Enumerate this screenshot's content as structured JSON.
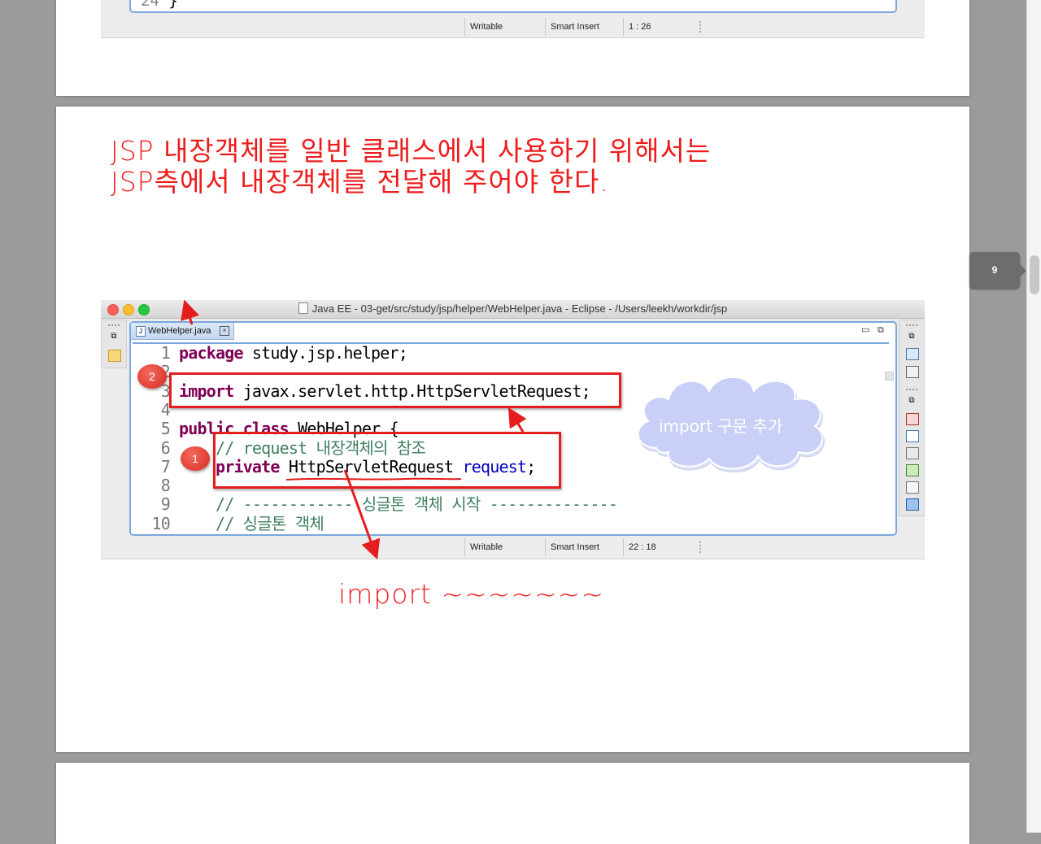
{
  "viewer": {
    "page_indicator": "9"
  },
  "prev_slide": {
    "visible_line_number": "24",
    "visible_code": "}",
    "status": {
      "writable": "Writable",
      "insert_mode": "Smart Insert",
      "position": "1 : 26"
    }
  },
  "slide": {
    "title_line1": "JSP 내장객체를 일반 클래스에서 사용하기 위해서는",
    "title_line2": "JSP측에서 내장객체를 전달해 주어야 한다.",
    "window_title": "Java EE - 03-get/src/study/jsp/helper/WebHelper.java - Eclipse - /Users/leekh/workdir/jsp",
    "editor_tab": "WebHelper.java",
    "code_lines": [
      {
        "num": "1",
        "parts": [
          {
            "t": "package",
            "c": "kw"
          },
          {
            "t": " study.jsp.helper;",
            "c": ""
          }
        ]
      },
      {
        "num": "2",
        "parts": []
      },
      {
        "num": "3",
        "parts": [
          {
            "t": "import",
            "c": "kw"
          },
          {
            "t": " javax.servlet.http.HttpServletRequest;",
            "c": ""
          }
        ]
      },
      {
        "num": "4",
        "parts": []
      },
      {
        "num": "5",
        "parts": [
          {
            "t": "public",
            "c": "kw"
          },
          {
            "t": " ",
            "c": ""
          },
          {
            "t": "class",
            "c": "kw"
          },
          {
            "t": " WebHelper {",
            "c": ""
          }
        ]
      },
      {
        "num": "6",
        "parts": [
          {
            "t": "    // request 내장객체의 참조",
            "c": "cm"
          }
        ]
      },
      {
        "num": "7",
        "parts": [
          {
            "t": "    ",
            "c": ""
          },
          {
            "t": "private",
            "c": "kw"
          },
          {
            "t": " HttpServletRequest ",
            "c": ""
          },
          {
            "t": "request",
            "c": "fld"
          },
          {
            "t": ";",
            "c": ""
          }
        ]
      },
      {
        "num": "8",
        "parts": []
      },
      {
        "num": "9",
        "parts": [
          {
            "t": "    // ------------ 싱글톤 객체 시작 --------------",
            "c": "cm"
          }
        ]
      },
      {
        "num": "10",
        "parts": [
          {
            "t": "    // 싱글톤 객체",
            "c": "cm"
          }
        ]
      }
    ],
    "status": {
      "writable": "Writable",
      "insert_mode": "Smart Insert",
      "position": "22 : 18"
    },
    "annotations": {
      "badge1": "1",
      "badge2": "2",
      "cloud_text": "import 구문 추가",
      "bottom_note": "import ~~~~~~~"
    }
  },
  "colors": {
    "annotation_red": "#e41e1e",
    "title_red": "#ee1c1c",
    "keyword": "#7f0055",
    "comment": "#3f7f5f",
    "field": "#0000c0",
    "cloud_fill": "#c9cff6",
    "editor_border": "#7aa7de"
  }
}
